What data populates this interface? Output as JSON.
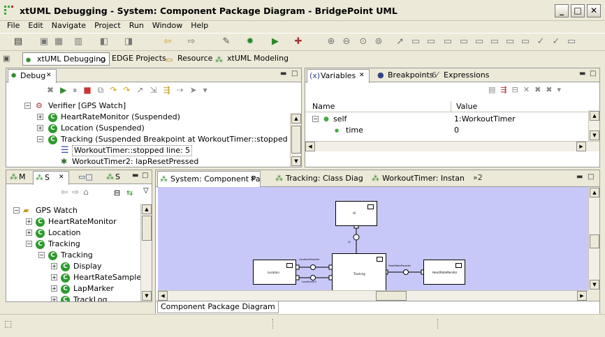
{
  "window": {
    "title": "xtUML Debugging - System: Component Package Diagram - BridgePoint UML"
  },
  "menu": [
    "File",
    "Edit",
    "Navigate",
    "Project",
    "Run",
    "Window",
    "Help"
  ],
  "perspectives": [
    "xtUML Debugging",
    "EDGE Projects",
    "Resource",
    "xtUML Modeling"
  ],
  "debug": {
    "tab": "Debug",
    "items": [
      {
        "label": "Verifier [GPS Watch]"
      },
      {
        "label": "HeartRateMonitor (Suspended)"
      },
      {
        "label": "Location (Suspended)"
      },
      {
        "label": "Tracking (Suspended Breakpoint at WorkoutTimer::stopped line: 5)"
      },
      {
        "label": "WorkoutTimer::stopped line: 5"
      },
      {
        "label": "WorkoutTimer2: lapResetPressed"
      }
    ]
  },
  "variables": {
    "tabs": [
      "Variables",
      "Breakpoints",
      "Expressions"
    ],
    "columns": [
      "Name",
      "Value"
    ],
    "rows": [
      {
        "name": "self",
        "value": "1:WorkoutTimer"
      },
      {
        "name": "time",
        "value": "0"
      }
    ]
  },
  "explorer": {
    "tabs": [
      "M",
      "S",
      "",
      "S"
    ],
    "items": [
      "GPS Watch",
      "HeartRateMonitor",
      "Location",
      "Tracking",
      "Tracking",
      "Display",
      "HeartRateSample",
      "LapMarker",
      "TrackLog"
    ]
  },
  "editor": {
    "tabs": [
      "System: Component Pa",
      "Tracking: Class Diag",
      "WorkoutTimer: Instan"
    ],
    "overflow": "»2",
    "bottom_tab": "Component Package Diagram",
    "diagram": {
      "components": [
        "UI",
        "Location",
        "Tracking",
        "HeartRateMonitor"
      ],
      "port_labels": [
        "LocationProvider",
        "LocationUtil",
        "HeartRateProvider",
        "UI"
      ]
    }
  }
}
